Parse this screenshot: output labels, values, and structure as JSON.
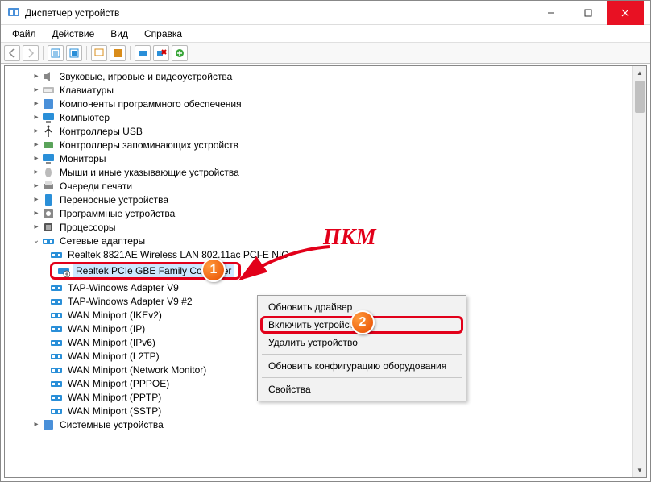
{
  "title": "Диспетчер устройств",
  "menu": [
    "Файл",
    "Действие",
    "Вид",
    "Справка"
  ],
  "categories": [
    {
      "label": "Звуковые, игровые и видеоустройства",
      "icon": "speaker"
    },
    {
      "label": "Клавиатуры",
      "icon": "keyboard"
    },
    {
      "label": "Компоненты программного обеспечения",
      "icon": "component"
    },
    {
      "label": "Компьютер",
      "icon": "monitor"
    },
    {
      "label": "Контроллеры USB",
      "icon": "usb"
    },
    {
      "label": "Контроллеры запоминающих устройств",
      "icon": "controller"
    },
    {
      "label": "Мониторы",
      "icon": "monitor"
    },
    {
      "label": "Мыши и иные указывающие устройства",
      "icon": "mouse"
    },
    {
      "label": "Очереди печати",
      "icon": "printer"
    },
    {
      "label": "Переносные устройства",
      "icon": "portable"
    },
    {
      "label": "Программные устройства",
      "icon": "software"
    },
    {
      "label": "Процессоры",
      "icon": "cpu"
    }
  ],
  "net_category_label": "Сетевые адаптеры",
  "net_adapters": [
    {
      "label": "Realtek 8821AE Wireless LAN 802.11ac PCI-E NIC"
    },
    {
      "label": "Realtek PCIe GBE Family Controller",
      "selected": true,
      "disabled": true
    },
    {
      "label": "TAP-Windows Adapter V9"
    },
    {
      "label": "TAP-Windows Adapter V9 #2"
    },
    {
      "label": "WAN Miniport (IKEv2)"
    },
    {
      "label": "WAN Miniport (IP)"
    },
    {
      "label": "WAN Miniport (IPv6)"
    },
    {
      "label": "WAN Miniport (L2TP)"
    },
    {
      "label": "WAN Miniport (Network Monitor)"
    },
    {
      "label": "WAN Miniport (PPPOE)"
    },
    {
      "label": "WAN Miniport (PPTP)"
    },
    {
      "label": "WAN Miniport (SSTP)"
    }
  ],
  "tail_category": "Системные устройства",
  "context_menu": {
    "update": "Обновить драйвер",
    "enable": "Включить устройство",
    "uninstall": "Удалить устройство",
    "scan": "Обновить конфигурацию оборудования",
    "props": "Свойства"
  },
  "annotation_text": "ПКМ",
  "badge1": "1",
  "badge2": "2"
}
